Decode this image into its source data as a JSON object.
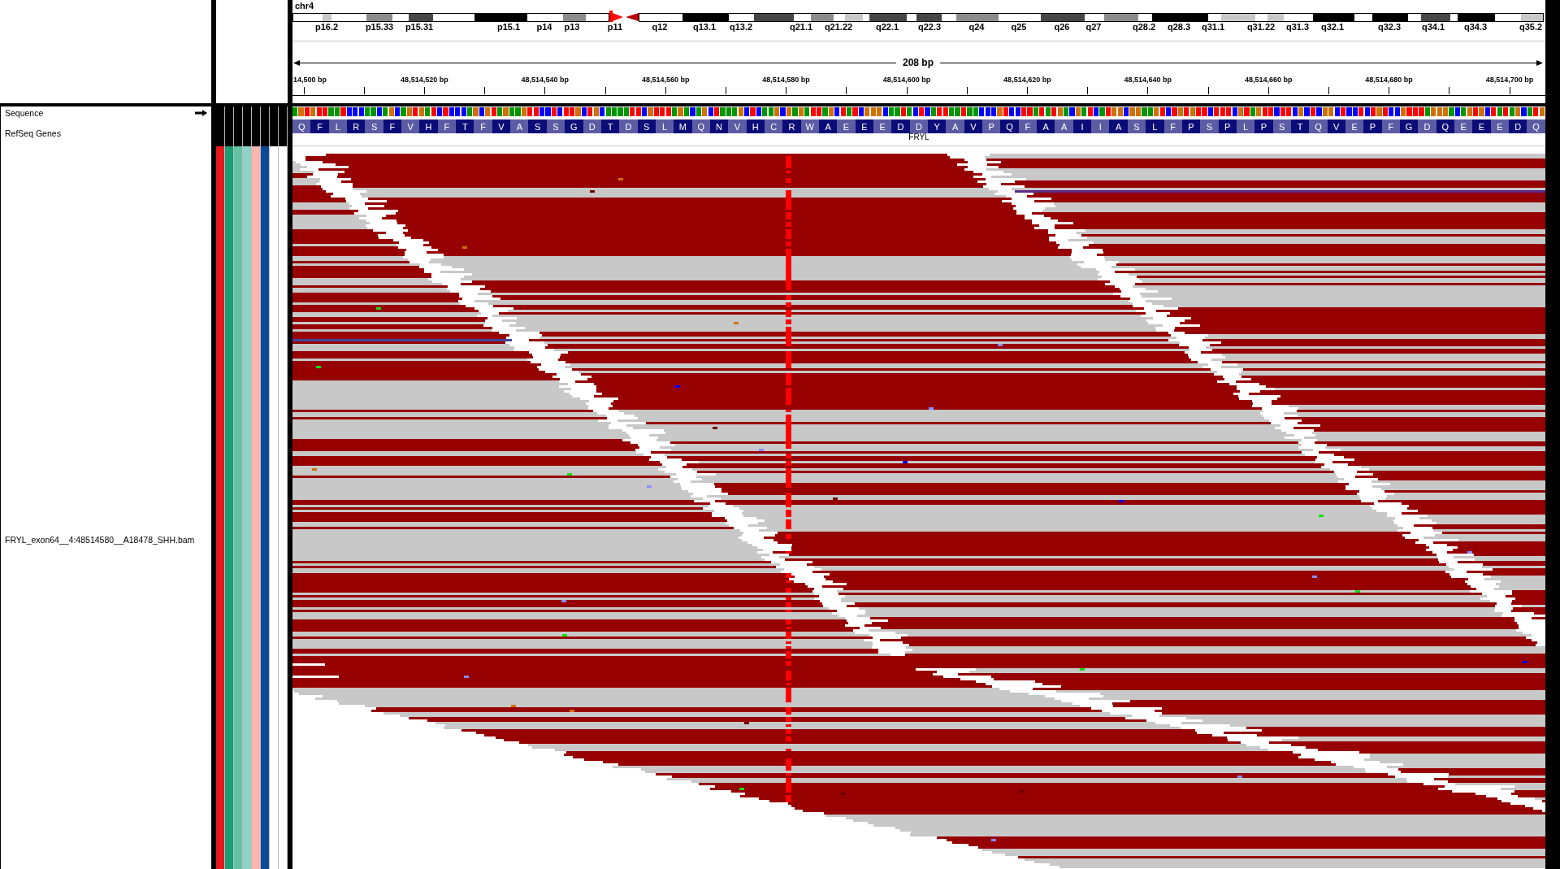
{
  "ideogram": {
    "chromosome": "chr4",
    "band_labels": [
      "p16.2",
      "p15.33",
      "p15.31",
      "p15.1",
      "p14",
      "p13",
      "p11",
      "q12",
      "q13.1",
      "q13.2",
      "q21.1",
      "q21.22",
      "q22.1",
      "q22.3",
      "q24",
      "q25",
      "q26",
      "q27",
      "q28.2",
      "q28.3",
      "q31.1",
      "q31.22",
      "q31.3",
      "q32.1",
      "q32.3",
      "q34.1",
      "q34.3",
      "q35.2"
    ]
  },
  "ruler": {
    "span": "208 bp",
    "tick_labels": [
      "14,500 bp",
      "48,514,520 bp",
      "48,514,540 bp",
      "48,514,560 bp",
      "48,514,580 bp",
      "48,514,600 bp",
      "48,514,620 bp",
      "48,514,640 bp",
      "48,514,660 bp",
      "48,514,680 bp",
      "48,514,700 bp"
    ]
  },
  "tracks": [
    {
      "kind": "sequence",
      "name": "Sequence"
    },
    {
      "kind": "genes",
      "name": "RefSeq Genes",
      "gene": "FRYL",
      "amino_acids": [
        "Q",
        "F",
        "L",
        "R",
        "S",
        "F",
        "V",
        "H",
        "F",
        "T",
        "F",
        "V",
        "A",
        "S",
        "S",
        "G",
        "D",
        "T",
        "D",
        "S",
        "L",
        "M",
        "Q",
        "N",
        "V",
        "H",
        "C",
        "R",
        "W",
        "A",
        "E",
        "E",
        "E",
        "D",
        "D",
        "Y",
        "A",
        "V",
        "P",
        "Q",
        "F",
        "A",
        "A",
        "I",
        "I",
        "A",
        "S",
        "L",
        "F",
        "P",
        "S",
        "P",
        "L",
        "P",
        "S",
        "T",
        "Q",
        "V",
        "E",
        "P",
        "F",
        "G",
        "D",
        "Q",
        "E",
        "E",
        "E",
        "D",
        "Q"
      ]
    },
    {
      "kind": "alignment",
      "name": "FRYL_exon64__4:48514580__A18478_SHH.bam",
      "attributes": [
        {
          "color": "#e41a1c"
        },
        {
          "color": "#1b9e77"
        },
        {
          "color": "#66c2a5"
        },
        {
          "color": "#8dd3c7"
        },
        {
          "color": "#fbb4ae"
        },
        {
          "color": "#0b4a96"
        },
        {
          "color": "#ffffff"
        },
        {
          "color": "#ffffff"
        }
      ]
    }
  ]
}
